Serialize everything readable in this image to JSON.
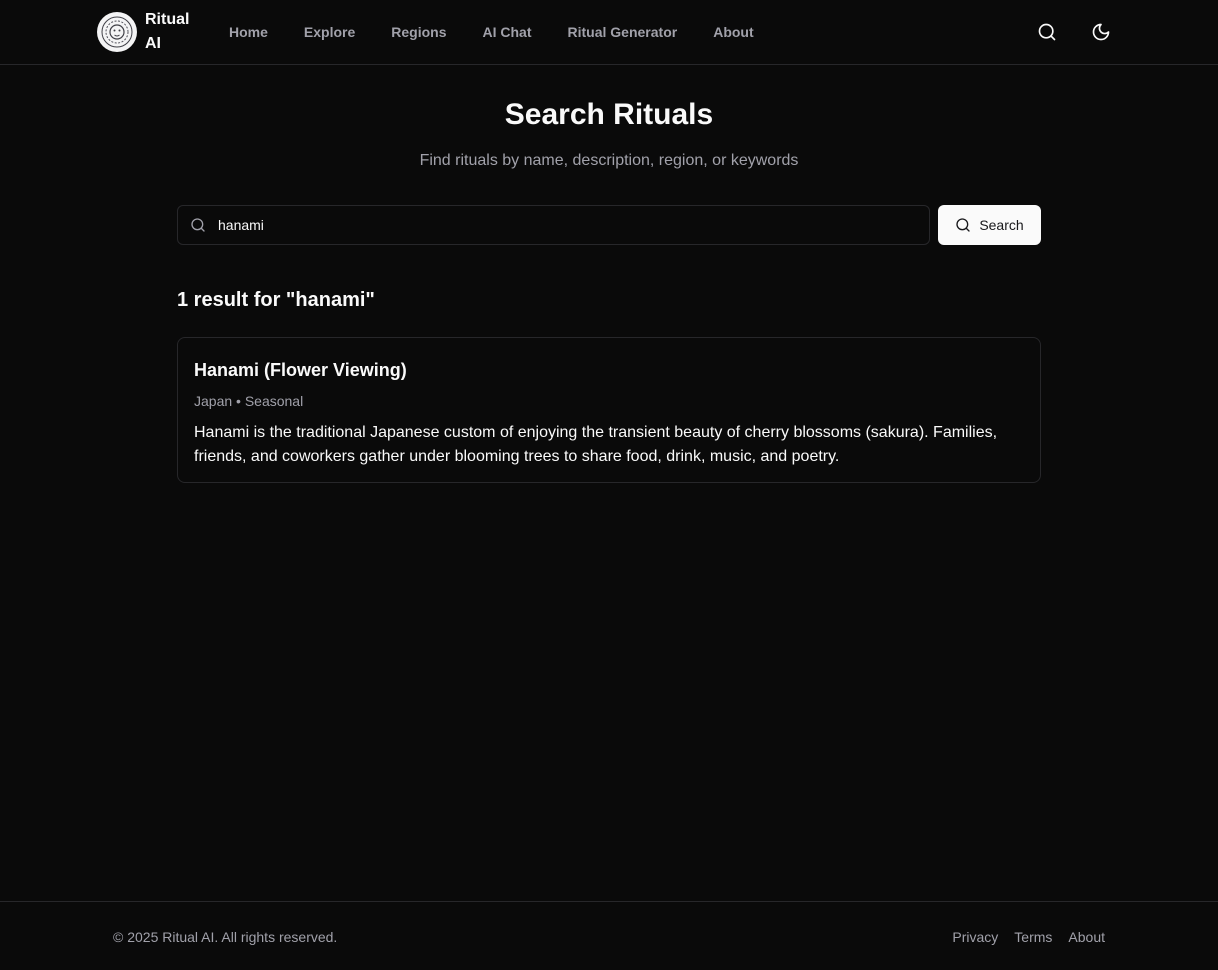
{
  "nav": {
    "brand": "Ritual AI",
    "links": [
      "Home",
      "Explore",
      "Regions",
      "AI Chat",
      "Ritual Generator",
      "About"
    ],
    "icons": {
      "logo": "lion-logo",
      "search": "search-icon",
      "theme": "moon-icon"
    }
  },
  "page": {
    "title": "Search Rituals",
    "subtitle": "Find rituals by name, description, region, or keywords"
  },
  "search": {
    "value": "hanami",
    "button_label": "Search"
  },
  "results": {
    "heading": "1 result for \"hanami\"",
    "items": [
      {
        "title": "Hanami (Flower Viewing)",
        "meta": "Japan • Seasonal",
        "description": "Hanami is the traditional Japanese custom of enjoying the transient beauty of cherry blossoms (sakura). Families, friends, and coworkers gather under blooming trees to share food, drink, music, and poetry."
      }
    ]
  },
  "footer": {
    "copyright": "© 2025 Ritual AI. All rights reserved.",
    "links": [
      "Privacy",
      "Terms",
      "About"
    ]
  },
  "colors": {
    "background": "#0a0a0a",
    "border": "#27272a",
    "text": "#fafafa",
    "muted": "#a1a1aa",
    "button_bg": "#fafafa"
  }
}
